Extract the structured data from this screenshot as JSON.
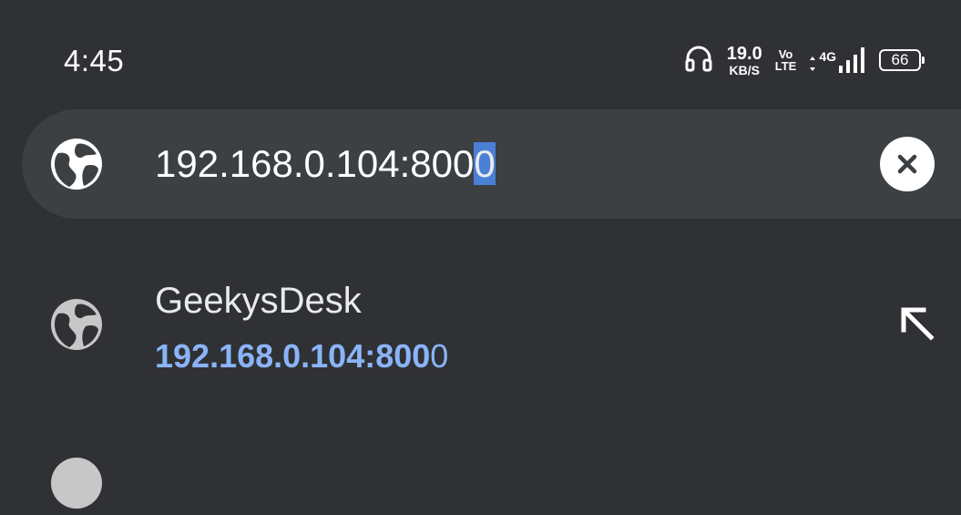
{
  "status": {
    "time": "4:45",
    "net_speed_value": "19.0",
    "net_speed_unit": "KB/S",
    "volte_top": "Vo",
    "volte_bottom": "LTE",
    "network": "4G",
    "battery": "66"
  },
  "omnibox": {
    "text_main": "192.168.0.104:800",
    "text_selected": "0",
    "icon": "globe-icon",
    "clear_icon": "close-icon"
  },
  "suggestion": {
    "title": "GeekysDesk",
    "url_match": "192.168.0.104:800",
    "url_rest": "0",
    "icon": "globe-icon",
    "action_icon": "arrow-up-left-icon"
  },
  "colors": {
    "background": "#303134",
    "omnibox_bg": "#3c4043",
    "link": "#8ab4f8",
    "selection": "#4a7fd6"
  }
}
